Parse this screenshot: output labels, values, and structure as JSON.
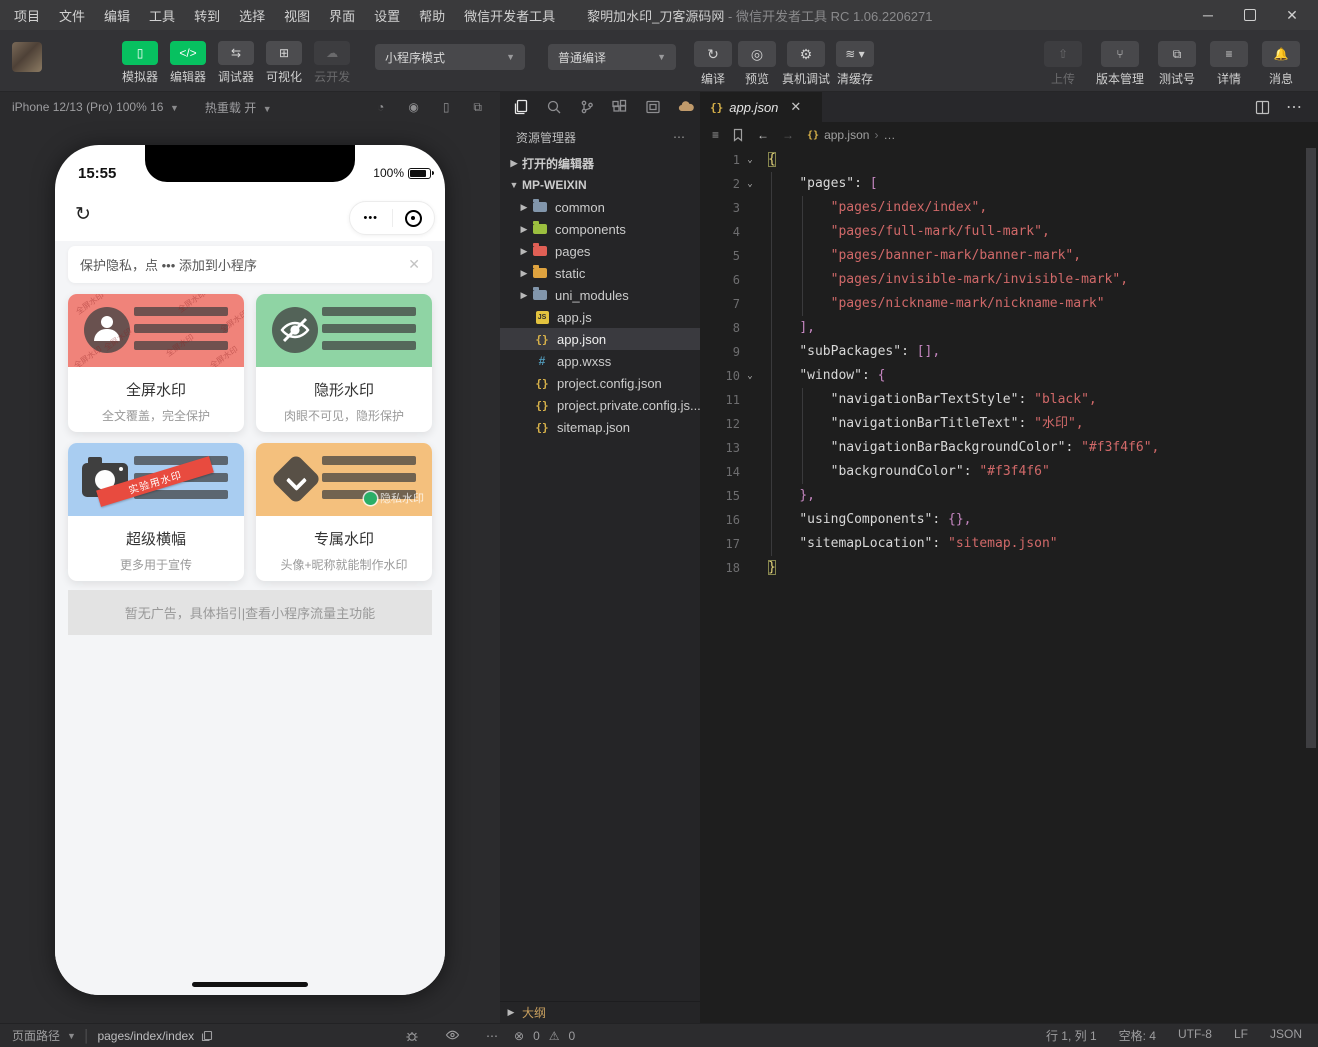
{
  "window": {
    "menus": [
      "项目",
      "文件",
      "编辑",
      "工具",
      "转到",
      "选择",
      "视图",
      "界面",
      "设置",
      "帮助",
      "微信开发者工具"
    ],
    "title": "黎明加水印_刀客源码网",
    "subtitle": " - 微信开发者工具 RC 1.06.2206271",
    "controls": {
      "minimize": "─",
      "close": "✕"
    }
  },
  "toolbar": {
    "modes": [
      {
        "label": "模拟器",
        "glyph": "▯",
        "state": "green",
        "icon": "simulator-icon"
      },
      {
        "label": "编辑器",
        "glyph": "</>",
        "state": "green",
        "icon": "editor-icon"
      },
      {
        "label": "调试器",
        "glyph": "⇆",
        "state": "normal",
        "icon": "debugger-icon"
      },
      {
        "label": "可视化",
        "glyph": "⊞",
        "state": "normal",
        "icon": "visual-icon"
      },
      {
        "label": "云开发",
        "glyph": "☁",
        "state": "disabled",
        "icon": "cloud-dev-icon"
      }
    ],
    "mode_dropdown": "小程序模式",
    "compile_dropdown": "普通编译",
    "compile_actions": [
      {
        "label": "编译",
        "icon": "refresh-icon",
        "glyph": "↻"
      },
      {
        "label": "预览",
        "icon": "eye-icon",
        "glyph": "◎"
      }
    ],
    "actions": [
      {
        "label": "真机调试",
        "icon": "bug-icon",
        "glyph": "⚙"
      },
      {
        "label": "清缓存",
        "icon": "layers-icon",
        "glyph": "≋",
        "caret": true
      }
    ],
    "right_actions": [
      {
        "label": "上传",
        "icon": "upload-icon",
        "glyph": "⇧",
        "disabled": true
      },
      {
        "label": "版本管理",
        "icon": "branch-icon",
        "glyph": "⑂"
      },
      {
        "label": "测试号",
        "icon": "external-icon",
        "glyph": "⧉"
      },
      {
        "label": "详情",
        "icon": "menu-icon",
        "glyph": "≡"
      },
      {
        "label": "消息",
        "icon": "bell-icon",
        "glyph": "🔔"
      }
    ]
  },
  "simulator": {
    "device": "iPhone 12/13 (Pro) 100% 16",
    "hot_reload": "热重载 开",
    "top_icons": [
      "restart-icon",
      "record-icon",
      "device-icon",
      "multi-window-icon"
    ],
    "phone": {
      "time": "15:55",
      "battery": "100%",
      "privacy_banner": "保护隐私，点 ••• 添加到小程序",
      "capsule_dots": "•••",
      "cards": [
        {
          "title": "全屏水印",
          "desc": "全文覆盖，完全保护",
          "color": "#f0837a",
          "type": "avatar",
          "watermark": "全屏水印"
        },
        {
          "title": "隐形水印",
          "desc": "肉眼不可见，隐形保护",
          "color": "#8fd4a4",
          "type": "eye-off"
        },
        {
          "title": "超级横幅",
          "desc": "更多用于宣传",
          "color": "#a9cdf1",
          "type": "camera",
          "ribbon": "实验用水印"
        },
        {
          "title": "专属水印",
          "desc": "头像+昵称就能制作水印",
          "color": "#f4c07d",
          "type": "diamond",
          "tag": "隐私水印"
        }
      ],
      "ad_text": "暂无广告，具体指引|查看小程序流量主功能"
    },
    "statusbar": {
      "path_label": "页面路径",
      "path": "pages/index/index"
    }
  },
  "explorer": {
    "title": "资源管理器",
    "strip_icons": [
      "files-icon",
      "search-icon",
      "source-control-icon",
      "extensions-icon",
      "window-icon",
      "cloud-icon"
    ],
    "tree": [
      {
        "label": "打开的编辑器",
        "kind": "section",
        "expanded": false
      },
      {
        "label": "MP-WEIXIN",
        "kind": "section",
        "expanded": true
      },
      {
        "label": "common",
        "kind": "folder",
        "color": "#8296ab"
      },
      {
        "label": "components",
        "kind": "folder",
        "color": "#9cbf3f"
      },
      {
        "label": "pages",
        "kind": "folder",
        "color": "#e05f55"
      },
      {
        "label": "static",
        "kind": "folder",
        "color": "#dfa33f"
      },
      {
        "label": "uni_modules",
        "kind": "folder",
        "color": "#8296ab"
      },
      {
        "label": "app.js",
        "kind": "file",
        "icon": "js"
      },
      {
        "label": "app.json",
        "kind": "file",
        "icon": "json",
        "selected": true
      },
      {
        "label": "app.wxss",
        "kind": "file",
        "icon": "wxss"
      },
      {
        "label": "project.config.json",
        "kind": "file",
        "icon": "json"
      },
      {
        "label": "project.private.config.js...",
        "kind": "file",
        "icon": "json"
      },
      {
        "label": "sitemap.json",
        "kind": "file",
        "icon": "json"
      }
    ],
    "outline": "大纲",
    "problems": {
      "errors": "0",
      "warnings": "0"
    }
  },
  "editor": {
    "tab": "app.json",
    "breadcrumb": {
      "file": "app.json",
      "more": "…"
    },
    "code": {
      "lines": [
        {
          "n": "1",
          "fold": true,
          "tk": [
            [
              "m",
              "{"
            ]
          ]
        },
        {
          "n": "2",
          "fold": true,
          "tk": [
            [
              "w",
              "    "
            ],
            [
              "k",
              "\"pages\""
            ],
            [
              "w",
              ": "
            ],
            [
              "p",
              "["
            ]
          ]
        },
        {
          "n": "3",
          "tk": [
            [
              "w",
              "        "
            ],
            [
              "s",
              "\"pages/index/index\","
            ]
          ]
        },
        {
          "n": "4",
          "tk": [
            [
              "w",
              "        "
            ],
            [
              "s",
              "\"pages/full-mark/full-mark\","
            ]
          ]
        },
        {
          "n": "5",
          "tk": [
            [
              "w",
              "        "
            ],
            [
              "s",
              "\"pages/banner-mark/banner-mark\","
            ]
          ]
        },
        {
          "n": "6",
          "tk": [
            [
              "w",
              "        "
            ],
            [
              "s",
              "\"pages/invisible-mark/invisible-mark\","
            ]
          ]
        },
        {
          "n": "7",
          "tk": [
            [
              "w",
              "        "
            ],
            [
              "s",
              "\"pages/nickname-mark/nickname-mark\""
            ]
          ]
        },
        {
          "n": "8",
          "tk": [
            [
              "w",
              "    "
            ],
            [
              "p",
              "],"
            ]
          ]
        },
        {
          "n": "9",
          "tk": [
            [
              "w",
              "    "
            ],
            [
              "k",
              "\"subPackages\""
            ],
            [
              "w",
              ": "
            ],
            [
              "p",
              "[],"
            ]
          ]
        },
        {
          "n": "10",
          "fold": true,
          "tk": [
            [
              "w",
              "    "
            ],
            [
              "k",
              "\"window\""
            ],
            [
              "w",
              ": "
            ],
            [
              "p",
              "{"
            ]
          ]
        },
        {
          "n": "11",
          "tk": [
            [
              "w",
              "        "
            ],
            [
              "k",
              "\"navigationBarTextStyle\""
            ],
            [
              "w",
              ": "
            ],
            [
              "s",
              "\"black\","
            ]
          ]
        },
        {
          "n": "12",
          "tk": [
            [
              "w",
              "        "
            ],
            [
              "k",
              "\"navigationBarTitleText\""
            ],
            [
              "w",
              ": "
            ],
            [
              "s",
              "\"水印\","
            ]
          ]
        },
        {
          "n": "13",
          "tk": [
            [
              "w",
              "        "
            ],
            [
              "k",
              "\"navigationBarBackgroundColor\""
            ],
            [
              "w",
              ": "
            ],
            [
              "s",
              "\"#f3f4f6\","
            ]
          ]
        },
        {
          "n": "14",
          "tk": [
            [
              "w",
              "        "
            ],
            [
              "k",
              "\"backgroundColor\""
            ],
            [
              "w",
              ": "
            ],
            [
              "s",
              "\"#f3f4f6\""
            ]
          ]
        },
        {
          "n": "15",
          "tk": [
            [
              "w",
              "    "
            ],
            [
              "p",
              "},"
            ]
          ]
        },
        {
          "n": "16",
          "tk": [
            [
              "w",
              "    "
            ],
            [
              "k",
              "\"usingComponents\""
            ],
            [
              "w",
              ": "
            ],
            [
              "p",
              "{},"
            ]
          ]
        },
        {
          "n": "17",
          "tk": [
            [
              "w",
              "    "
            ],
            [
              "k",
              "\"sitemapLocation\""
            ],
            [
              "w",
              ": "
            ],
            [
              "s",
              "\"sitemap.json\""
            ]
          ]
        },
        {
          "n": "18",
          "tk": [
            [
              "m",
              "}"
            ]
          ]
        }
      ]
    }
  },
  "statusbar": {
    "items": [
      "行 1, 列 1",
      "空格: 4",
      "UTF-8",
      "LF",
      "JSON"
    ]
  },
  "colors": {
    "accent_green": "#07c160",
    "string_token": "#d16969",
    "punct_token": "#c586c0",
    "nav_background": "#f3f4f6"
  }
}
